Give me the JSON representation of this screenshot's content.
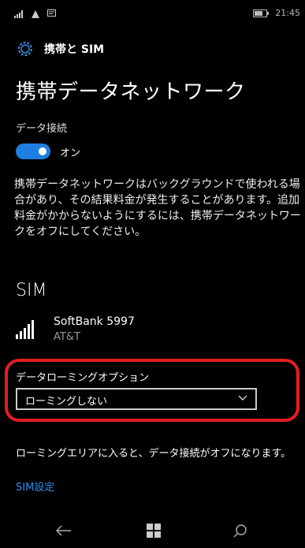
{
  "status": {
    "signal_icon": "signal-icon",
    "wifi_icon": "wifi-icon",
    "message_icon": "message-icon",
    "battery_icon": "battery-icon",
    "time": "21:45"
  },
  "header": {
    "title": "携帯と SIM",
    "icon": "gear-icon"
  },
  "page": {
    "title": "携帯データネットワーク",
    "data_connection_label": "データ接続",
    "toggle_state": "オン",
    "toggle_on": true,
    "description": "携帯データネットワークはバックグラウンドで使われる場合があり、その結果料金が発生することがあります。追加料金がかからないようにするには、携帯データネットワークをオフにしてください。"
  },
  "sim": {
    "section_title": "SIM",
    "carrier": "SoftBank 5997",
    "network": "AT&T"
  },
  "roaming": {
    "label": "データローミングオプション",
    "selected": "ローミングしない",
    "note": "ローミングエリアに入ると、データ接続がオフになります。"
  },
  "links": {
    "sim_settings": "SIM設定"
  },
  "nav": {
    "back_icon": "back-arrow-icon",
    "start_icon": "windows-logo-icon",
    "search_icon": "search-icon"
  },
  "colors": {
    "accent": "#1e7fe0",
    "link": "#2e8cf0",
    "highlight": "#e31e24"
  }
}
